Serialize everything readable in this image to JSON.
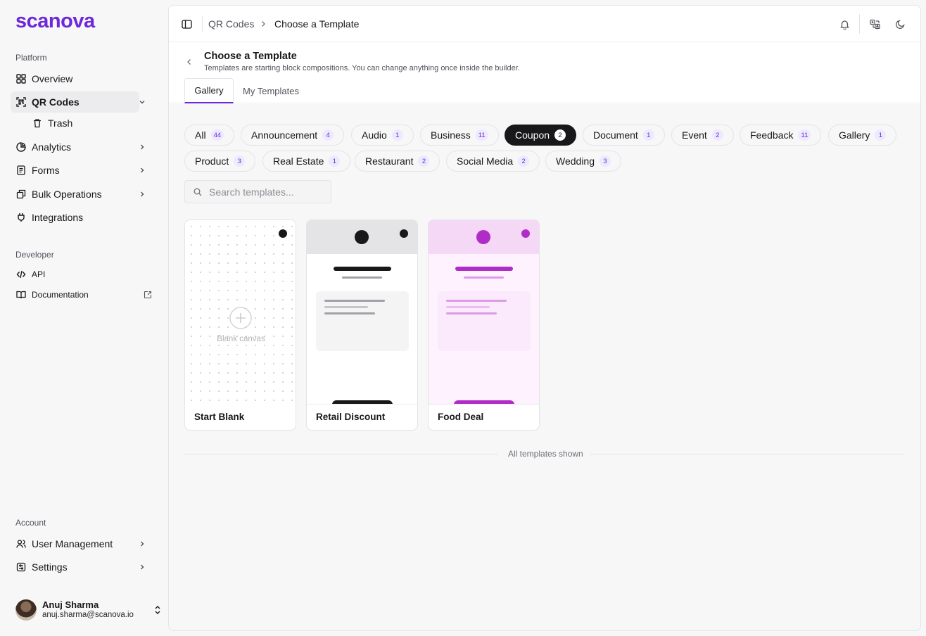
{
  "brand": {
    "logo_text": "scanova",
    "accent": "#6d28d9"
  },
  "sidebar": {
    "platform_label": "Platform",
    "platform_items": [
      {
        "label": "Overview",
        "icon": "grid-icon"
      },
      {
        "label": "QR Codes",
        "icon": "qr-scan-icon",
        "active": true
      },
      {
        "label": "Trash",
        "icon": "trash-icon"
      },
      {
        "label": "Analytics",
        "icon": "chart-icon"
      },
      {
        "label": "Forms",
        "icon": "form-icon"
      },
      {
        "label": "Bulk Operations",
        "icon": "boxes-icon"
      },
      {
        "label": "Integrations",
        "icon": "plug-icon"
      }
    ],
    "developer_label": "Developer",
    "developer_items": [
      {
        "label": "API",
        "icon": "code-icon"
      },
      {
        "label": "Documentation",
        "icon": "book-icon"
      }
    ],
    "account_label": "Account",
    "account_items": [
      {
        "label": "User Management",
        "icon": "users-icon"
      },
      {
        "label": "Settings",
        "icon": "settings-icon"
      }
    ],
    "user": {
      "name": "Anuj Sharma",
      "email": "anuj.sharma@scanova.io"
    }
  },
  "topbar": {
    "breadcrumb_parent": "QR Codes",
    "breadcrumb_current": "Choose a Template"
  },
  "header": {
    "title": "Choose a Template",
    "subtitle": "Templates are starting block compositions. You can change anything once inside the builder.",
    "tabs": [
      {
        "label": "Gallery",
        "active": true
      },
      {
        "label": "My Templates",
        "active": false
      }
    ]
  },
  "filters": [
    {
      "label": "All",
      "count": "44"
    },
    {
      "label": "Announcement",
      "count": "4"
    },
    {
      "label": "Audio",
      "count": "1"
    },
    {
      "label": "Business",
      "count": "11"
    },
    {
      "label": "Coupon",
      "count": "2",
      "active": true
    },
    {
      "label": "Document",
      "count": "1"
    },
    {
      "label": "Event",
      "count": "2"
    },
    {
      "label": "Feedback",
      "count": "11"
    },
    {
      "label": "Gallery",
      "count": "1"
    },
    {
      "label": "Product",
      "count": "3"
    },
    {
      "label": "Real Estate",
      "count": "1"
    },
    {
      "label": "Restaurant",
      "count": "2"
    },
    {
      "label": "Social Media",
      "count": "2"
    },
    {
      "label": "Wedding",
      "count": "3"
    }
  ],
  "search": {
    "placeholder": "Search templates..."
  },
  "templates": [
    {
      "name": "Start Blank",
      "blank_label": "Blank canvas",
      "color": "#18181b"
    },
    {
      "name": "Retail Discount",
      "color": "#18181b"
    },
    {
      "name": "Food Deal",
      "color": "#b02cc6"
    }
  ],
  "footer_note": "All templates shown"
}
